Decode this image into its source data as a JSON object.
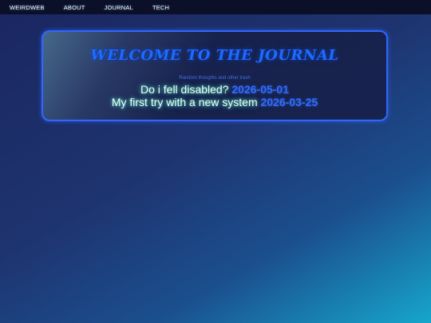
{
  "nav": {
    "items": [
      {
        "label": "WEIRDWEB"
      },
      {
        "label": "ABOUT"
      },
      {
        "label": "JOURNAL"
      },
      {
        "label": "TECH"
      }
    ]
  },
  "journal": {
    "title": "WELCOME TO THE JOURNAL",
    "subtitle": "Random thoughts and other trash",
    "entries": [
      {
        "title": "Do i fell disabled?",
        "date": "2026-05-01"
      },
      {
        "title": "My first try with a new system",
        "date": "2026-03-25"
      }
    ]
  },
  "colors": {
    "accent": "#2f67ff",
    "nav_background": "#0b0f27",
    "entry_glow": "#78ffdc",
    "title": "#1e6bff"
  }
}
